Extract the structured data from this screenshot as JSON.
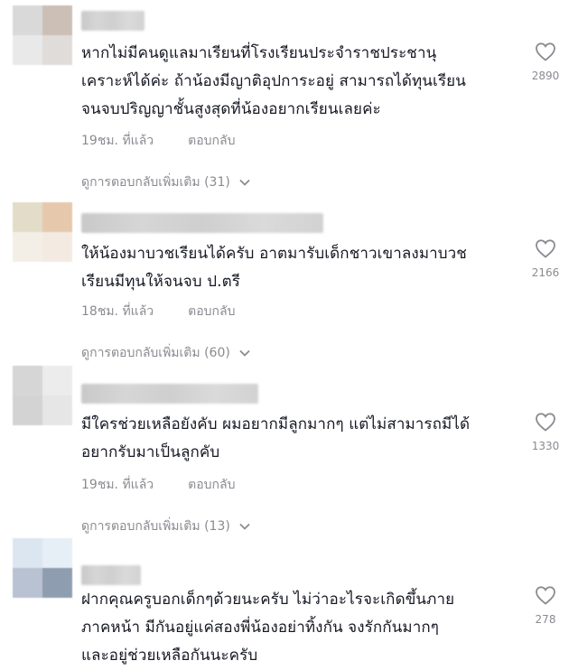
{
  "comments": [
    {
      "text": "หากไม่มีคนดูแลมาเรียนที่โรงเรียนประจำราชประชานุ\nเคราะห์ได้ค่ะ ถ้าน้องมีญาติอุปการะอยู่ สามารถได้ทุนเรียน\nจนจบปริญญาชั้นสูงสุดที่น้องอยากเรียนเลยค่ะ",
      "time": "19ชม. ที่แล้ว",
      "reply_label": "ตอบกลับ",
      "likes": "2890",
      "more_replies": "ดูการตอบกลับเพิ่มเติม (31)",
      "avatar_colors": [
        "#d9d9d9",
        "#ccbfb6",
        "#e9e9e9",
        "#e0dcd9"
      ]
    },
    {
      "text": "ให้น้องมาบวชเรียนได้ครับ อาตมารับเด็กชาวเขาลงมาบวช\nเรียนมีทุนให้จนจบ ป.ตรี",
      "time": "18ชม. ที่แล้ว",
      "reply_label": "ตอบกลับ",
      "likes": "2166",
      "more_replies": "ดูการตอบกลับเพิ่มเติม (60)",
      "avatar_colors": [
        "#e2dcc8",
        "#e6c8ad",
        "#f3efe6",
        "#f3ebe2"
      ]
    },
    {
      "text": "มีใครช่วยเหลือยังคับ ผมอยากมีลูกมากๆ แต่ไม่สามารถมีได้\nอยากรับมาเป็นลูกคับ",
      "time": "19ชม. ที่แล้ว",
      "reply_label": "ตอบกลับ",
      "likes": "1330",
      "more_replies": "ดูการตอบกลับเพิ่มเติม (13)",
      "avatar_colors": [
        "#d6d6d6",
        "#ececec",
        "#d3d3d3",
        "#e6e6e6"
      ]
    },
    {
      "text": "ฝากคุณครูบอกเด็กๆด้วยนะครับ ไม่ว่าอะไรจะเกิดขึ้นภาย\nภาคหน้า มีกันอยู่แค่สองพี่น้องอย่าทิ้งกัน จงรักกันมากๆ\nและอยู่ช่วยเหลือกันนะครับ",
      "time": "",
      "reply_label": "",
      "likes": "278",
      "more_replies": "",
      "avatar_colors": [
        "#dce6f1",
        "#e6eef6",
        "#b8c2d2",
        "#8f9db0"
      ]
    }
  ],
  "colors": {
    "text": "#161823",
    "muted": "#8a8b91",
    "heart_outline": "#8a8b91"
  },
  "icons": {
    "like": "heart-outline-icon",
    "expand": "chevron-down-icon"
  }
}
